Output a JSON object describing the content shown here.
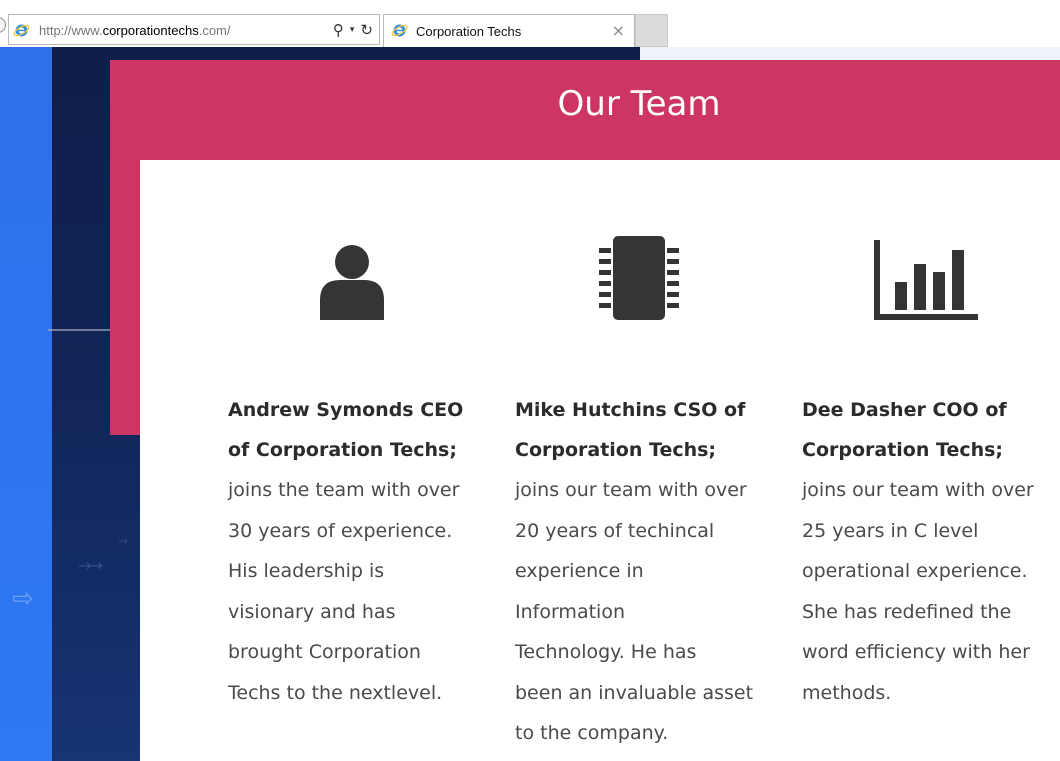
{
  "browser": {
    "url_prefix": "http://www.",
    "url_domain": "corporationtechs",
    "url_suffix": ".com/",
    "tab_title": "Corporation Techs",
    "tab_close": "×",
    "search_glyph": "⚲",
    "dropdown_glyph": "▾",
    "refresh_glyph": "↻",
    "browser_icon": "internet-explorer-icon"
  },
  "section": {
    "title": "Our Team",
    "accent_color": "#cd3562"
  },
  "team": [
    {
      "icon": "person-icon",
      "name_lines": [
        "Andrew Symonds CEO",
        "of Corporation Techs;"
      ],
      "bio_lines": [
        "joins the team with over",
        "30 years of experience.",
        "His leadership is",
        "visionary and has",
        "brought Corporation",
        "Techs to the nextlevel."
      ]
    },
    {
      "icon": "microchip-icon",
      "name_lines": [
        "Mike Hutchins CSO of",
        "Corporation Techs;"
      ],
      "bio_lines": [
        "joins our team with over",
        "20 years of techincal",
        "experience in",
        "Information",
        "Technology.  He has",
        "been an invaluable asset",
        "to the company."
      ]
    },
    {
      "icon": "bar-chart-icon",
      "name_lines": [
        "Dee Dasher COO of",
        "Corporation Techs;"
      ],
      "bio_lines": [
        "joins our team with over",
        "25 years in C level",
        "operational experience.",
        "She has redefined the",
        "word efficiency with her",
        "methods."
      ]
    }
  ]
}
